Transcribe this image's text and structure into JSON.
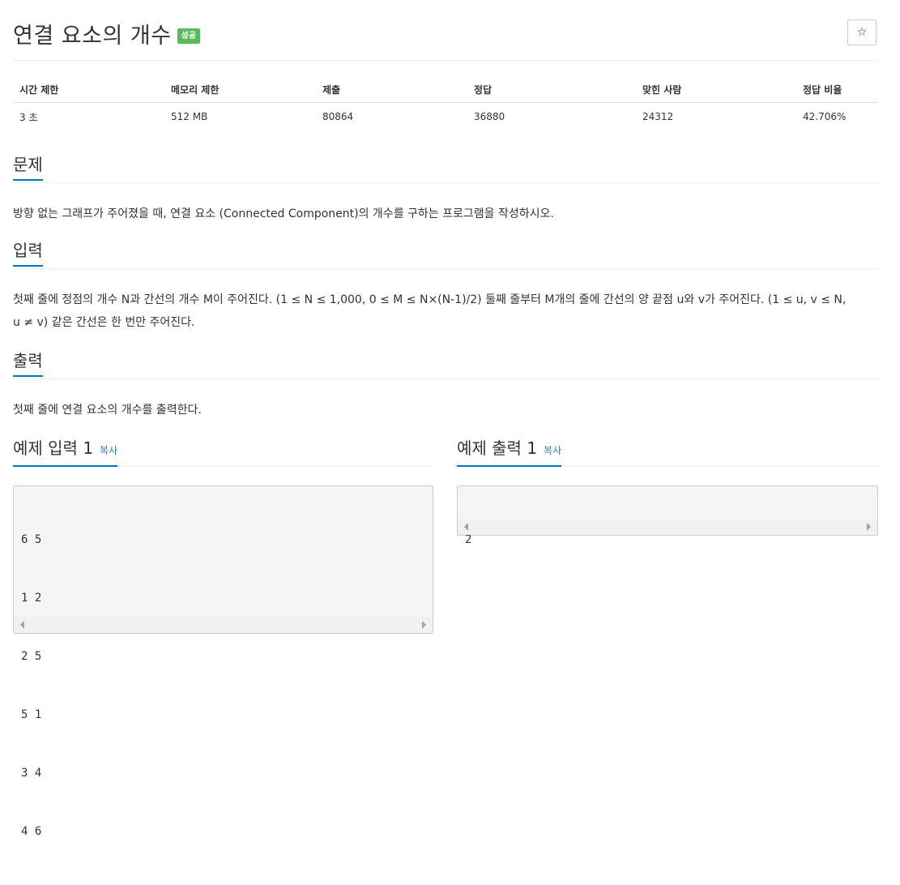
{
  "problem": {
    "title": "연결 요소의 개수",
    "result_badge": "성공",
    "star_icon": "☆"
  },
  "info_table": {
    "headers": [
      "시간 제한",
      "메모리 제한",
      "제출",
      "정답",
      "맞힌 사람",
      "정답 비율"
    ],
    "values": [
      "3 초",
      "512 MB",
      "80864",
      "36880",
      "24312",
      "42.706%"
    ]
  },
  "sections": {
    "description": {
      "heading": "문제",
      "text": "방향 없는 그래프가 주어졌을 때, 연결 요소 (Connected Component)의 개수를 구하는 프로그램을 작성하시오."
    },
    "input": {
      "heading": "입력",
      "line1": "첫째 줄에 정점의 개수 N과 간선의 개수 M이 주어진다. (1 ≤ N ≤ 1,000, 0 ≤ M ≤ N×(N-1)/2) 둘째 줄부터 M개의 줄에 간선의 양 끝점 u와 v가 주어진다. (1 ≤ u, v ≤ N,",
      "line2": "u ≠ v) 같은 간선은 한 번만 주어진다."
    },
    "output": {
      "heading": "출력",
      "text": "첫째 줄에 연결 요소의 개수를 출력한다."
    }
  },
  "samples": {
    "input": {
      "heading": "예제 입력 1",
      "copy_label": "복사",
      "lines": [
        "6 5",
        "1 2",
        "2 5",
        "5 1",
        "3 4",
        "4 6"
      ]
    },
    "output": {
      "heading": "예제 출력 1",
      "copy_label": "복사",
      "lines": [
        "2"
      ]
    }
  },
  "colors": {
    "accent": "#0076c0",
    "success_badge": "#5cb85c",
    "link": "#337ab7"
  }
}
